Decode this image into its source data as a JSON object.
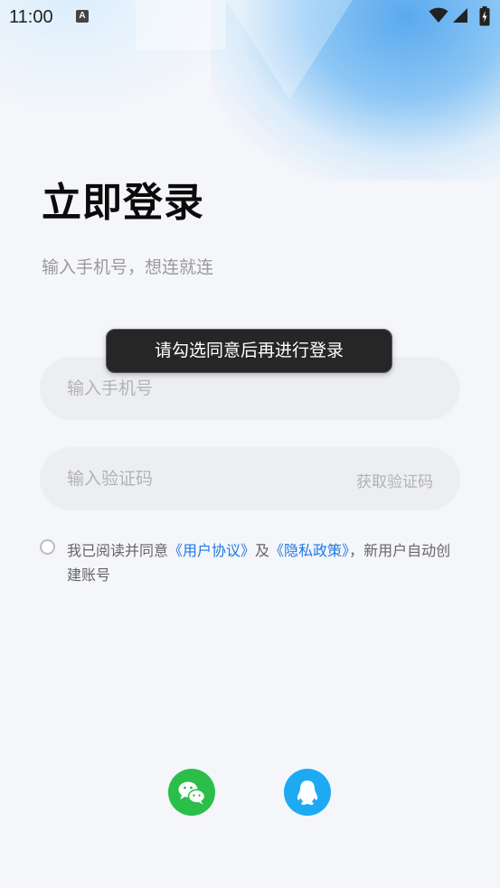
{
  "status_bar": {
    "time": "11:00",
    "notification_icon": "A",
    "icons": [
      "wifi-icon",
      "signal-icon",
      "battery-charging-icon"
    ]
  },
  "login": {
    "title": "立即登录",
    "subtitle": "输入手机号，想连就连",
    "phone_placeholder": "输入手机号",
    "code_placeholder": "输入验证码",
    "get_code_label": "获取验证码"
  },
  "agreement": {
    "prefix": "我已阅读并同意",
    "user_agreement": "《用户协议》",
    "and": "及",
    "privacy_policy": "《隐私政策》",
    "suffix": "，新用户自动创建账号",
    "checked": false
  },
  "social_login": [
    {
      "name": "WeChat",
      "icon": "wechat-icon",
      "color": "#2bbf4a"
    },
    {
      "name": "QQ",
      "icon": "qq-icon",
      "color": "#1eaaf2"
    }
  ],
  "toast": {
    "message": "请勾选同意后再进行登录"
  },
  "colors": {
    "background": "#f5f6fa",
    "link": "#1e78e8",
    "field_bg": "#eceef2",
    "toast_bg": "#262626"
  }
}
